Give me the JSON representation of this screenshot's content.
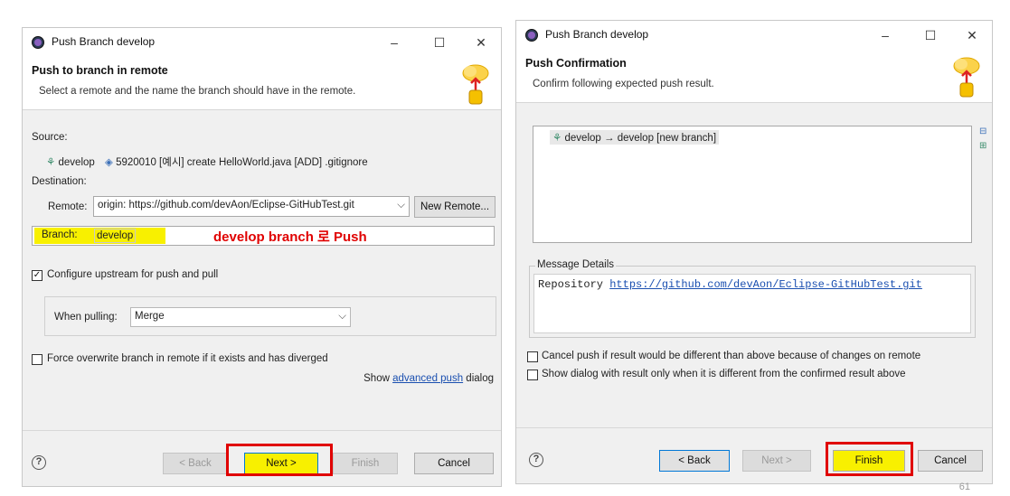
{
  "dialog1": {
    "window_title": "Push Branch develop",
    "header_title": "Push to branch in remote",
    "header_desc": "Select a remote and the name the branch should have in the remote.",
    "source_label": "Source:",
    "source_branch": "develop",
    "source_commit": "5920010 [예시] create HelloWorld.java [ADD] .gitignore",
    "destination_label": "Destination:",
    "remote_label": "Remote:",
    "remote_value": "origin: https://github.com/devAon/Eclipse-GitHubTest.git",
    "new_remote_button": "New Remote...",
    "branch_label": "Branch:",
    "branch_value": "develop",
    "annotation": "develop branch 로 Push",
    "configure_upstream_label": "Configure upstream for push and pull",
    "configure_upstream_checked": true,
    "when_pulling_label": "When pulling:",
    "when_pulling_value": "Merge",
    "force_overwrite_label": "Force overwrite branch in remote if it exists and has diverged",
    "force_overwrite_checked": false,
    "advanced_prefix": "Show ",
    "advanced_link": "advanced push",
    "advanced_suffix": " dialog",
    "back_button": "< Back",
    "next_button": "Next >",
    "finish_button": "Finish",
    "cancel_button": "Cancel"
  },
  "dialog2": {
    "window_title": "Push Branch develop",
    "header_title": "Push Confirmation",
    "header_desc": "Confirm following expected push result.",
    "result_item": "develop → develop [new branch]",
    "message_details_label": "Message Details",
    "message_prefix": "Repository ",
    "message_link": "https://github.com/devAon/Eclipse-GitHubTest.git",
    "cancel_push_label": "Cancel push if result would be different than above because of changes on remote",
    "show_dialog_label": "Show dialog with result only when it is different from the confirmed result above",
    "back_button": "< Back",
    "next_button": "Next >",
    "finish_button": "Finish",
    "cancel_button": "Cancel"
  },
  "page_number": "61",
  "colors": {
    "highlight": "#f8f000",
    "annotation_red": "#e00000",
    "link": "#1a4fb0"
  }
}
